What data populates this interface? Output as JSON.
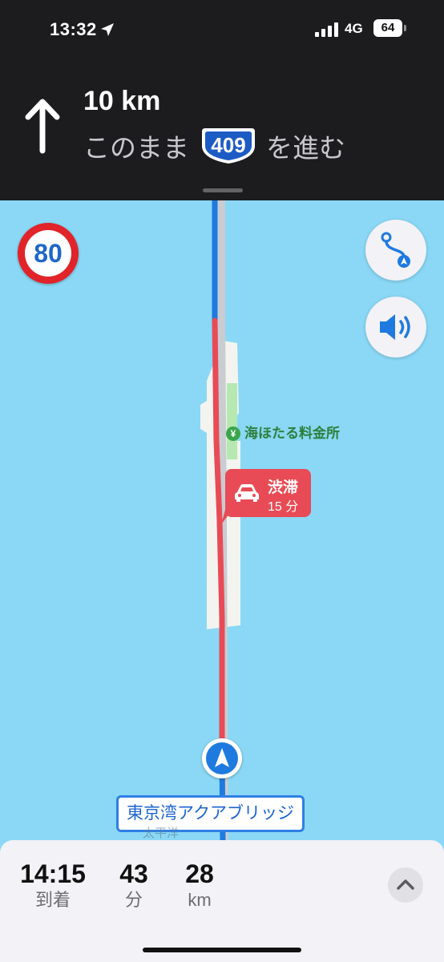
{
  "status_bar": {
    "time": "13:32",
    "network": "4G",
    "battery": "64"
  },
  "navigation": {
    "distance": "10 km",
    "instruction_prefix": "このまま",
    "route_number": "409",
    "instruction_suffix": "を進む",
    "maneuver_icon": "straight-arrow-icon"
  },
  "map": {
    "speed_limit": "80",
    "poi_label": "海ほたる料金所",
    "traffic_title": "渋滞",
    "traffic_delay": "15 分",
    "road_name": "東京湾アクアブリッジ",
    "sea_label": "太平洋",
    "colors": {
      "water": "#8ad8f5",
      "route": "#1f7ae0",
      "congestion": "#e84b55"
    }
  },
  "trip": {
    "arrival_time": "14:15",
    "arrival_label": "到着",
    "minutes": "43",
    "minutes_label": "分",
    "distance": "28",
    "distance_label": "km"
  }
}
